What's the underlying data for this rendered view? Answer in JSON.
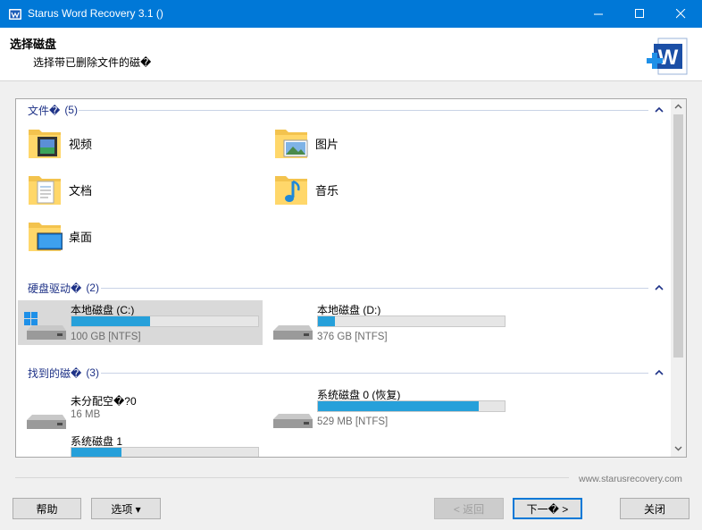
{
  "window": {
    "title": "Starus Word Recovery 3.1 ()",
    "accent": "#0078d7"
  },
  "header": {
    "title": "选择磁盘",
    "subtitle": "选择带已删除文件的磁�"
  },
  "groups": {
    "folders": {
      "label": "文件�",
      "count": "(5)",
      "items": [
        {
          "label": "视频",
          "icon": "video-folder-icon"
        },
        {
          "label": "图片",
          "icon": "pictures-folder-icon"
        },
        {
          "label": "文档",
          "icon": "documents-folder-icon"
        },
        {
          "label": "音乐",
          "icon": "music-folder-icon"
        },
        {
          "label": "桌面",
          "icon": "desktop-folder-icon"
        }
      ]
    },
    "drives": {
      "label": "硬盘驱动�",
      "count": "(2)",
      "items": [
        {
          "name": "本地磁盘 (C:)",
          "size": "100 GB [NTFS]",
          "used": 0.42
        },
        {
          "name": "本地磁盘 (D:)",
          "size": "376 GB [NTFS]",
          "used": 0.09
        }
      ]
    },
    "found": {
      "label": "找到的磁�",
      "count": "(3)",
      "items": [
        {
          "name": "未分配空�?0",
          "size": "16 MB"
        },
        {
          "name": "系统磁盘 0 (恢复)",
          "size": "529 MB [NTFS]",
          "used": 0.86
        },
        {
          "name": "系统磁盘 1",
          "size": "",
          "used": 0.27
        }
      ]
    }
  },
  "footer": {
    "website": "www.starusrecovery.com"
  },
  "buttons": {
    "help": "帮助",
    "options": "选项 ▾",
    "back": "< 返回",
    "next": "下一� >",
    "close": "关闭"
  }
}
